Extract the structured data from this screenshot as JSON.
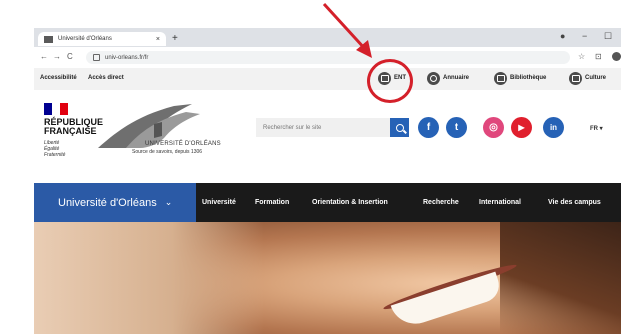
{
  "browser": {
    "tab_title": "Université d'Orléans",
    "tab_close": "×",
    "new_tab": "+",
    "url": "univ-orleans.fr/fr",
    "back": "←",
    "forward": "→",
    "reload": "C",
    "star": "☆",
    "ext": "⊡",
    "minimize": "−",
    "maximize": "☐",
    "dot": "●"
  },
  "utility_bar": {
    "accessibility": "Accessibilité",
    "quick_access": "Accès direct",
    "links": [
      {
        "label": "ENT",
        "icon": "screen-icon"
      },
      {
        "label": "Annuaire",
        "icon": "search-icon"
      },
      {
        "label": "Bibliothèque",
        "icon": "book-icon"
      },
      {
        "label": "Culture",
        "icon": "culture-icon"
      }
    ]
  },
  "header": {
    "republic_line1": "RÉPUBLIQUE",
    "republic_line2": "FRANÇAISE",
    "motto_1": "Liberté",
    "motto_2": "Égalité",
    "motto_3": "Fraternité",
    "university_name": "UNIVERSITÉ D'ORLÉANS",
    "university_tagline": "Source de savoirs, depuis 1306",
    "search_placeholder": "Rechercher sur le site",
    "language": "FR ▾",
    "social": [
      {
        "name": "facebook-icon",
        "glyph": "f",
        "color": "#2662b6"
      },
      {
        "name": "twitter-icon",
        "glyph": "t",
        "color": "#2662b6"
      },
      {
        "name": "instagram-icon",
        "glyph": "◎",
        "color": "#e0477c"
      },
      {
        "name": "youtube-icon",
        "glyph": "▶",
        "color": "#e01f2d"
      },
      {
        "name": "linkedin-icon",
        "glyph": "in",
        "color": "#2662b6"
      }
    ]
  },
  "navbar": {
    "brand": "Université d'Orléans",
    "brand_chevron": "⌄",
    "items": [
      "Université",
      "Formation",
      "Orientation & Insertion",
      "Recherche",
      "International",
      "Vie des campus"
    ]
  },
  "colors": {
    "brand_blue": "#2b5aa6",
    "nav_dark": "#1a1a1a",
    "annotation_red": "#d4202a"
  }
}
